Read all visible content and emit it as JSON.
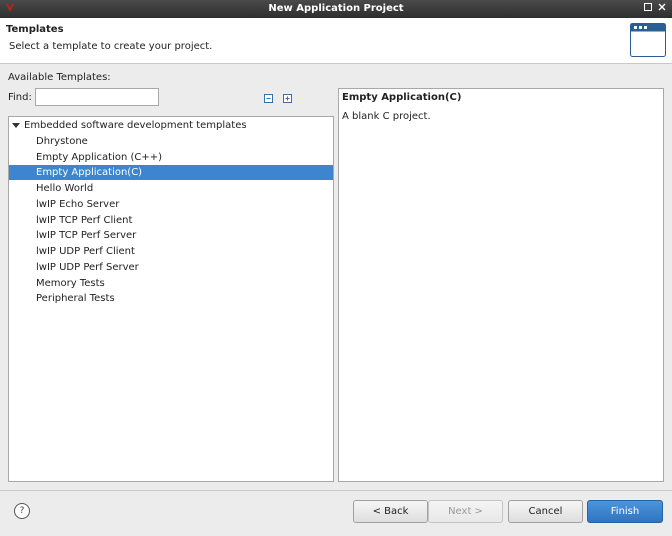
{
  "window": {
    "title": "New Application Project"
  },
  "header": {
    "title": "Templates",
    "description": "Select a template to create your project."
  },
  "templates": {
    "section_label": "Available Templates:",
    "find_label": "Find:",
    "find_value": "",
    "root_label": "Embedded software development templates",
    "items": [
      "Dhrystone",
      "Empty Application (C++)",
      "Empty Application(C)",
      "Hello World",
      "lwIP Echo Server",
      "lwIP TCP Perf Client",
      "lwIP TCP Perf Server",
      "lwIP UDP Perf Client",
      "lwIP UDP Perf Server",
      "Memory Tests",
      "Peripheral Tests"
    ],
    "selected_index": 2
  },
  "description": {
    "title": "Empty Application(C)",
    "text": "A blank C project."
  },
  "buttons": {
    "back": "< Back",
    "next": "Next >",
    "cancel": "Cancel",
    "finish": "Finish",
    "help": "?"
  },
  "icons": {
    "app": "app-logo-icon",
    "minimize": "minimize-icon",
    "close": "close-icon",
    "wizard": "wizard-window-icon",
    "collapse_all": "collapse-all-icon",
    "expand_all": "expand-all-icon",
    "help": "help-icon"
  },
  "colors": {
    "selection": "#3d86cf",
    "primary_button": "#2f74c0",
    "titlebar": "#2e2e2e",
    "app_icon": "#c0201a"
  }
}
